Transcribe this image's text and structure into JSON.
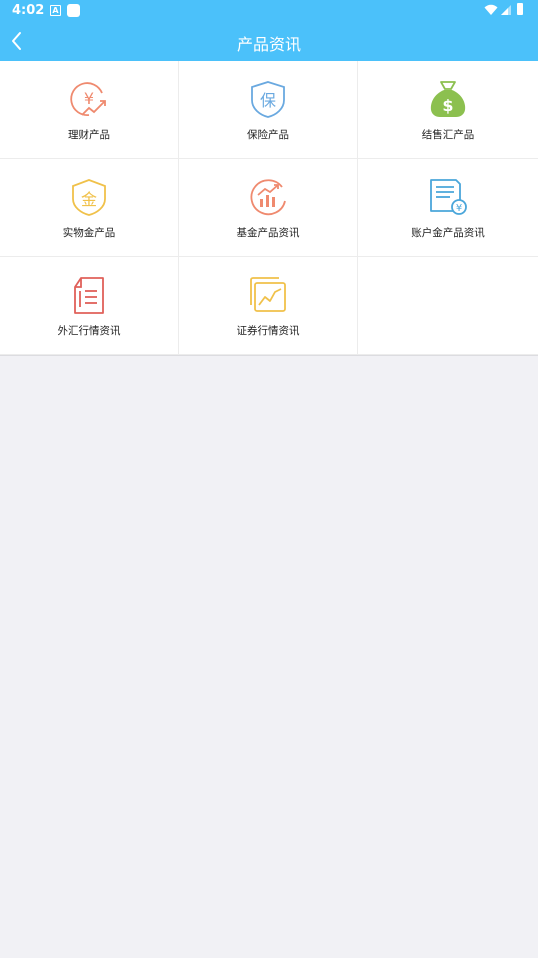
{
  "status_bar": {
    "time": "4:02",
    "a_icon_text": "A"
  },
  "app_bar": {
    "title": "产品资讯",
    "back_icon": "chevron-left-icon"
  },
  "grid": {
    "items": [
      {
        "label": "理财产品",
        "icon": "yuan-growth-icon",
        "color": "#ef8a6f"
      },
      {
        "label": "保险产品",
        "icon": "insurance-shield-icon",
        "color": "#6aa9e0"
      },
      {
        "label": "结售汇产品",
        "icon": "money-bag-icon",
        "color": "#8cc04f"
      },
      {
        "label": "实物金产品",
        "icon": "gold-shield-icon",
        "color": "#f0c14a"
      },
      {
        "label": "基金产品资讯",
        "icon": "fund-chart-icon",
        "color": "#ef8a6f"
      },
      {
        "label": "账户金产品资讯",
        "icon": "account-document-icon",
        "color": "#4aa6da"
      },
      {
        "label": "外汇行情资讯",
        "icon": "forex-document-icon",
        "color": "#e0605a"
      },
      {
        "label": "证券行情资讯",
        "icon": "securities-chart-icon",
        "color": "#f0c14a"
      }
    ],
    "icon_texts": {
      "yuan": "¥",
      "bao": "保",
      "dollar": "$",
      "jin": "金"
    }
  }
}
